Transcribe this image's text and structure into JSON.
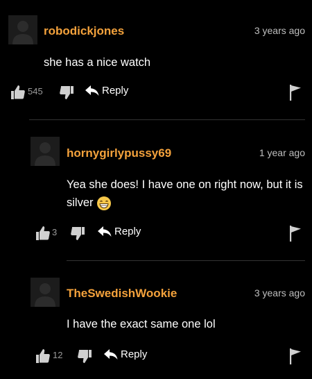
{
  "comments": [
    {
      "username": "robodickjones",
      "time": "3 years ago",
      "text": "she has a nice watch",
      "likes": "545",
      "reply_label": "Reply"
    },
    {
      "username": "hornygirlypussy69",
      "time": "1 year ago",
      "text": "Yea she does! I have one on right now, but it is silver",
      "likes": "3",
      "reply_label": "Reply"
    },
    {
      "username": "TheSwedishWookie",
      "time": "3 years ago",
      "text": "I have the exact same one lol",
      "likes": "12",
      "reply_label": "Reply"
    }
  ],
  "icons": {
    "avatar": "default-avatar-icon",
    "thumbs_up": "thumbs-up-icon",
    "thumbs_down": "thumbs-down-icon",
    "reply": "reply-arrow-icon",
    "flag": "flag-icon",
    "emoji": "grinning-face-emoji-icon"
  },
  "colors": {
    "background": "#000000",
    "username": "#f4a23c",
    "time": "#bfbfbf",
    "count": "#9a9a9a",
    "divider": "#333333"
  }
}
